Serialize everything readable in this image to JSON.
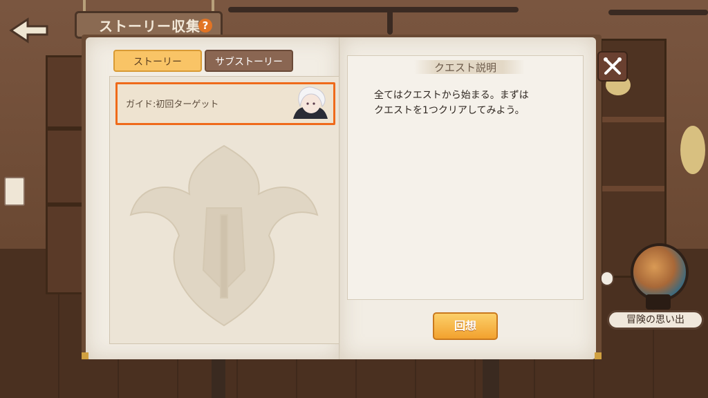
{
  "header": {
    "title": "ストーリー収集",
    "help_glyph": "?"
  },
  "tabs": [
    {
      "label": "ストーリー",
      "active": true
    },
    {
      "label": "サブストーリー",
      "active": false
    }
  ],
  "story_list": [
    {
      "label": "ガイド:初回ターゲット",
      "selected": true
    }
  ],
  "quest": {
    "title": "クエスト説明",
    "description": "全てはクエストから始まる。まずは\nクエストを1つクリアしてみよう。"
  },
  "buttons": {
    "recall": "回想",
    "memories": "冒険の思い出"
  },
  "colors": {
    "accent_orange": "#ef6a1a",
    "tab_active": "#f9c466",
    "tab_inactive": "#8a6652",
    "button_gold": "#f2a12e",
    "page": "#f2ede4"
  },
  "icons": {
    "back": "back-arrow-icon",
    "help": "help-icon",
    "close": "crossed-swords-close-icon",
    "globe": "globe-icon"
  }
}
